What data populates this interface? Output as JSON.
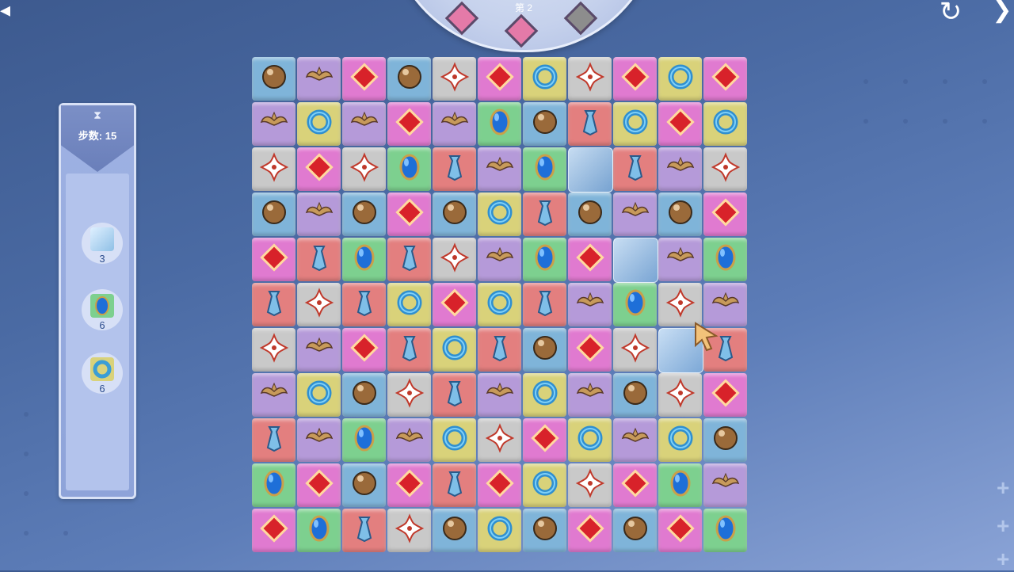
{
  "hud": {
    "steps_label": "步数: 15",
    "level_text": "第 2",
    "stars": [
      {
        "state": "filled",
        "color": "#e47aa8"
      },
      {
        "state": "filled",
        "color": "#e47aa8"
      },
      {
        "state": "empty",
        "color": "#8d8d8d"
      }
    ]
  },
  "goals": [
    {
      "icon": "ice-block-icon",
      "count": "3"
    },
    {
      "icon": "blue-mirror-icon",
      "count": "6"
    },
    {
      "icon": "blue-ribbon-icon",
      "count": "6"
    }
  ],
  "colors": {
    "ball": "#7fb4d9",
    "wings": "#b59ad9",
    "diamond": "#e07ad0",
    "flower": "#c9c9c9",
    "ribbon": "#d9d27a",
    "mirror": "#7dd08f",
    "tie": "#e37f7f"
  },
  "board": {
    "rows": [
      [
        "ball",
        "wings",
        "diamond",
        "ball",
        "flower",
        "diamond",
        "ribbon",
        "flower",
        "diamond",
        "ribbon",
        "diamond"
      ],
      [
        "wings",
        "ribbon",
        "wings",
        "diamond",
        "wings",
        "mirror",
        "ball",
        "tie",
        "ribbon",
        "diamond",
        "ribbon"
      ],
      [
        "flower",
        "diamond",
        "flower",
        "mirror",
        "tie",
        "wings",
        "mirror",
        "ice",
        "tie",
        "wings",
        "flower"
      ],
      [
        "ball",
        "wings",
        "ball",
        "diamond",
        "ball",
        "ribbon",
        "tie",
        "ball",
        "wings",
        "ball",
        "diamond"
      ],
      [
        "diamond",
        "tie",
        "mirror",
        "tie",
        "flower",
        "wings",
        "mirror",
        "diamond",
        "ice",
        "wings",
        "mirror"
      ],
      [
        "tie",
        "flower",
        "tie",
        "ribbon",
        "diamond",
        "ribbon",
        "tie",
        "wings",
        "mirror",
        "flower",
        "wings"
      ],
      [
        "flower",
        "wings",
        "diamond",
        "tie",
        "ribbon",
        "tie",
        "ball",
        "diamond",
        "flower",
        "ice",
        "tie"
      ],
      [
        "wings",
        "ribbon",
        "ball",
        "flower",
        "tie",
        "wings",
        "ribbon",
        "wings",
        "ball",
        "flower",
        "diamond"
      ],
      [
        "tie",
        "wings",
        "mirror",
        "wings",
        "ribbon",
        "flower",
        "diamond",
        "ribbon",
        "wings",
        "ribbon",
        "ball"
      ],
      [
        "mirror",
        "diamond",
        "ball",
        "diamond",
        "tie",
        "diamond",
        "ribbon",
        "flower",
        "diamond",
        "mirror",
        "wings"
      ],
      [
        "diamond",
        "mirror",
        "tie",
        "flower",
        "ball",
        "ribbon",
        "ball",
        "diamond",
        "ball",
        "diamond",
        "mirror"
      ]
    ]
  }
}
